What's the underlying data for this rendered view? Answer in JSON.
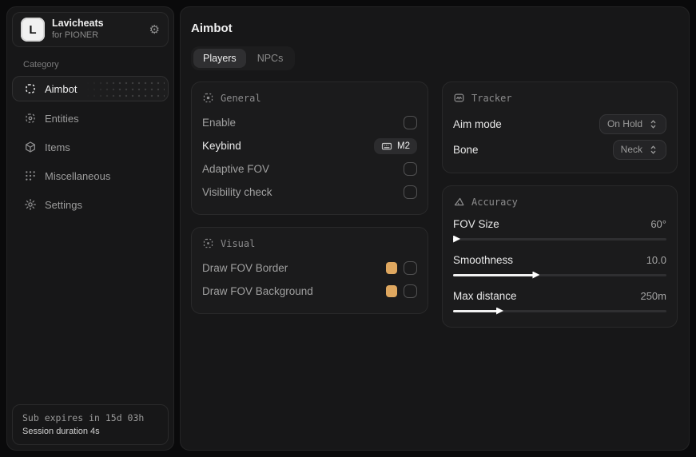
{
  "app": {
    "name": "Lavicheats",
    "subtitle": "for PIONER",
    "logo_letter": "L"
  },
  "sidebar": {
    "category_label": "Category",
    "items": [
      {
        "label": "Aimbot"
      },
      {
        "label": "Entities"
      },
      {
        "label": "Items"
      },
      {
        "label": "Miscellaneous"
      },
      {
        "label": "Settings"
      }
    ],
    "footer": {
      "line1": "Sub expires in 15d 03h",
      "line2": "Session duration 4s"
    }
  },
  "main": {
    "title": "Aimbot",
    "tabs": {
      "players": "Players",
      "npcs": "NPCs"
    },
    "general": {
      "title": "General",
      "enable_label": "Enable",
      "keybind_label": "Keybind",
      "keybind_value": "M2",
      "adaptive_fov_label": "Adaptive FOV",
      "visibility_label": "Visibility check"
    },
    "visual": {
      "title": "Visual",
      "border_label": "Draw FOV Border",
      "background_label": "Draw FOV Background",
      "swatch_color": "#dfa75f"
    },
    "tracker": {
      "title": "Tracker",
      "aim_mode_label": "Aim mode",
      "aim_mode_value": "On Hold",
      "bone_label": "Bone",
      "bone_value": "Neck"
    },
    "accuracy": {
      "title": "Accuracy",
      "sliders": [
        {
          "label": "FOV Size",
          "value": "60°",
          "fill_pct": 0.8
        },
        {
          "label": "Smoothness",
          "value": "10.0",
          "fill_pct": 38
        },
        {
          "label": "Max distance",
          "value": "250m",
          "fill_pct": 21
        }
      ]
    }
  },
  "icons": {
    "gear": "⚙"
  }
}
